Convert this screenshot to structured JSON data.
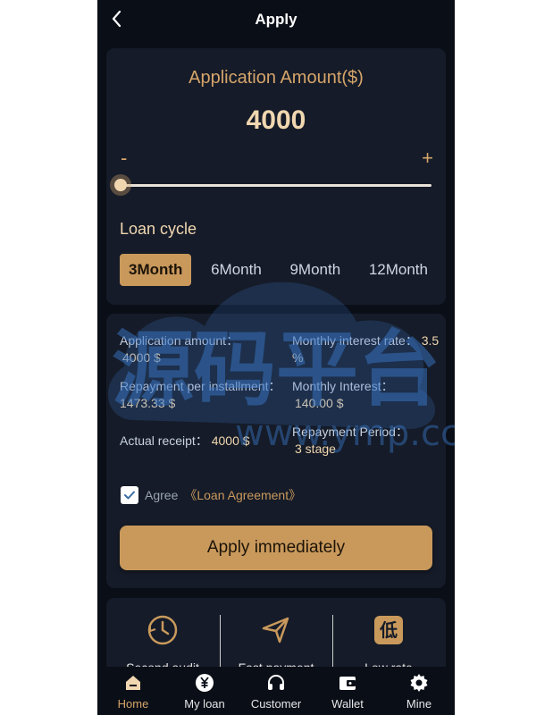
{
  "header": {
    "title": "Apply"
  },
  "amount_card": {
    "label": "Application Amount($)",
    "value": "4000",
    "minus": "-",
    "plus": "+",
    "slider_fraction": 0
  },
  "loan_cycle": {
    "label": "Loan cycle",
    "options": [
      "3Month",
      "6Month",
      "9Month",
      "12Month"
    ],
    "selected": "3Month"
  },
  "details": {
    "application_amount_label": "Application amount：",
    "application_amount_value": "4000 $",
    "monthly_rate_label": "Monthly interest rate：",
    "monthly_rate_value": "3.5 %",
    "repayment_per_installment_label": "Repayment per installment：",
    "repayment_per_installment_value": "1473.33 $",
    "monthly_interest_label": "Monthly Interest：",
    "monthly_interest_value": "140.00 $",
    "actual_receipt_label": "Actual receipt：",
    "actual_receipt_value": "4000 $",
    "repayment_period_label": "Repayment Period：",
    "repayment_period_value": "3 stage"
  },
  "agreement": {
    "checked": true,
    "prefix": "Agree",
    "link": "《Loan Agreement》"
  },
  "apply_button": "Apply immediately",
  "features": [
    {
      "label": "Second audit",
      "icon": "clock-history-icon"
    },
    {
      "label": "Fast payment",
      "icon": "send-arrow-icon"
    },
    {
      "label": "Low rate",
      "icon": "low-rate-badge-icon",
      "glyph": "低"
    }
  ],
  "tabbar": [
    {
      "label": "Home",
      "icon": "home-icon",
      "active": true
    },
    {
      "label": "My loan",
      "icon": "yen-coin-icon",
      "active": false
    },
    {
      "label": "Customer",
      "icon": "headset-icon",
      "active": false
    },
    {
      "label": "Wallet",
      "icon": "wallet-icon",
      "active": false
    },
    {
      "label": "Mine",
      "icon": "gear-icon",
      "active": false
    }
  ],
  "watermark": {
    "text": "源码平台",
    "url": "www.ymp.cc"
  },
  "colors": {
    "accent": "#c9995c",
    "accent_light": "#f1d7b0",
    "background": "#0a0e17",
    "card": "#151b28"
  }
}
